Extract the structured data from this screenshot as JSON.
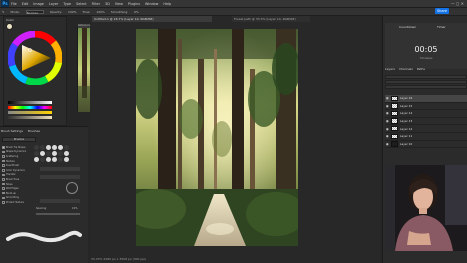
{
  "app": {
    "menu": [
      "File",
      "Edit",
      "Image",
      "Layer",
      "Type",
      "Select",
      "Filter",
      "3D",
      "View",
      "Plugins",
      "Window",
      "Help"
    ],
    "window_controls": "—  ◻  ✕",
    "share_label": "Share"
  },
  "options_bar": {
    "items": [
      "Mode:",
      "Normal",
      "Opacity:",
      "100%",
      "Flow:",
      "100%",
      "Smoothing:",
      "0%"
    ]
  },
  "color_panel": {
    "tab_label": "Color"
  },
  "reference_window": {
    "title": "Reference"
  },
  "brush_settings": {
    "tabs": [
      "Brush Settings",
      "Brushes"
    ],
    "presets_label": "Brushes",
    "options": [
      {
        "label": "Brush Tip Shape",
        "checked": true
      },
      {
        "label": "Shape Dynamics",
        "checked": true
      },
      {
        "label": "Scattering",
        "checked": false
      },
      {
        "label": "Texture",
        "checked": false
      },
      {
        "label": "Dual Brush",
        "checked": false
      },
      {
        "label": "Color Dynamics",
        "checked": false
      },
      {
        "label": "Transfer",
        "checked": true
      },
      {
        "label": "Brush Pose",
        "checked": false
      },
      {
        "label": "Noise",
        "checked": false
      },
      {
        "label": "Wet Edges",
        "checked": false
      },
      {
        "label": "Build-up",
        "checked": false
      },
      {
        "label": "Smoothing",
        "checked": true
      },
      {
        "label": "Protect Texture",
        "checked": false
      }
    ],
    "spacing_label": "Spacing",
    "spacing_value": "10%"
  },
  "document": {
    "tab_title": "Untitled-1 @ 16.7% (Layer 10, RGB/8#)",
    "tab2_title": "Forest path @ 33.3% (Layer 14, RGB/8#)",
    "status": "33.33%   2480 px x 3508 px (300 ppi)"
  },
  "timer_panel": {
    "tab_a": "Countdown",
    "tab_b": "Timer",
    "time": "00:05",
    "sub": "Timelapse"
  },
  "layers_panel": {
    "tabs": [
      "Layers",
      "Channels",
      "Paths"
    ],
    "layers": [
      {
        "name": "Layer 16",
        "selected": true,
        "dark": false
      },
      {
        "name": "Layer 15",
        "selected": false,
        "dark": false
      },
      {
        "name": "Layer 14",
        "selected": false,
        "dark": false
      },
      {
        "name": "Layer 13",
        "selected": false,
        "dark": false
      },
      {
        "name": "Layer 12",
        "selected": false,
        "dark": false
      },
      {
        "name": "Layer 11",
        "selected": false,
        "dark": false
      },
      {
        "name": "Layer 10",
        "selected": false,
        "dark": true
      }
    ]
  },
  "colors": {
    "accent": "#1473e6",
    "panel": "#2b2b2b",
    "selected_layer": "#464646"
  }
}
